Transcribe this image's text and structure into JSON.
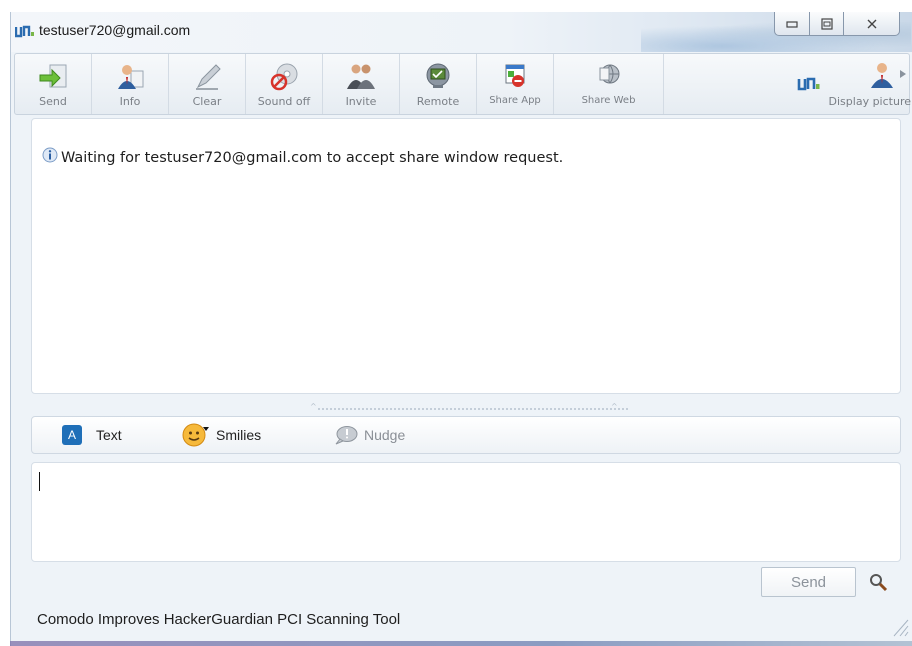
{
  "window": {
    "title": "testuser720@gmail.com",
    "controls": {
      "minimize": "minimize",
      "maximize": "maximize",
      "close": "close"
    }
  },
  "toolbar": {
    "items": [
      {
        "label": "Send",
        "icon": "send-file-icon"
      },
      {
        "label": "Info",
        "icon": "user-info-icon"
      },
      {
        "label": "Clear",
        "icon": "clear-pen-icon"
      },
      {
        "label": "Sound off",
        "icon": "sound-off-icon"
      },
      {
        "label": "Invite",
        "icon": "invite-users-icon"
      },
      {
        "label": "Remote",
        "icon": "remote-desktop-icon"
      },
      {
        "label": "Share App",
        "icon": "share-app-icon"
      },
      {
        "label": "Share Web",
        "icon": "share-web-icon"
      }
    ],
    "display_picture_label": "Display picture"
  },
  "conversation": {
    "status_message": "Waiting for testuser720@gmail.com to accept share window request."
  },
  "formatbar": {
    "text_icon_letter": "A",
    "text_label": "Text",
    "smilies_label": "Smilies",
    "nudge_label": "Nudge"
  },
  "compose": {
    "value": "",
    "send_label": "Send"
  },
  "statusbar": {
    "text": "Comodo Improves HackerGuardian PCI Scanning Tool"
  },
  "colors": {
    "accent": "#1f6fb8",
    "window_bg": "#eef3f8",
    "toolbar_label": "#7a7f86"
  }
}
